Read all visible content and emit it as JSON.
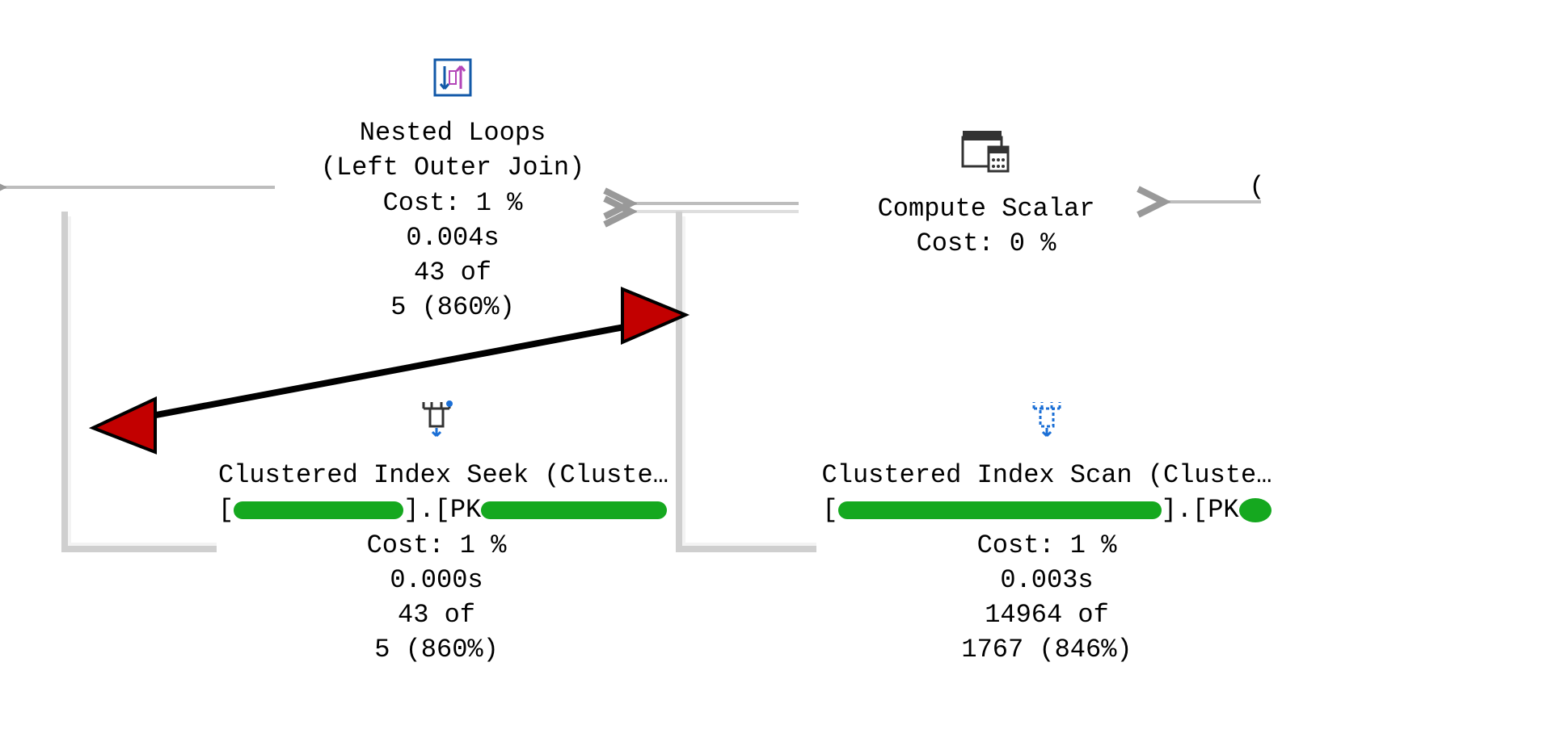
{
  "nodes": {
    "nested_loops": {
      "title": "Nested Loops",
      "subtitle": "(Left Outer Join)",
      "cost": "Cost: 1 %",
      "time": "0.004s",
      "rows_line1": "43 of",
      "rows_line2": "5 (860%)"
    },
    "compute_scalar": {
      "title": "Compute Scalar",
      "cost": "Cost: 0 %"
    },
    "index_seek": {
      "title": "Clustered Index Seek (Cluste…",
      "object_prefix": "[",
      "object_mid": "].[PK",
      "cost": "Cost: 1 %",
      "time": "0.000s",
      "rows_line1": "43 of",
      "rows_line2": "5 (860%)"
    },
    "index_scan": {
      "title": "Clustered Index Scan (Cluste…",
      "object_prefix": "[",
      "object_mid": "].[PK",
      "cost": "Cost: 1 %",
      "time": "0.003s",
      "rows_line1": "14964 of",
      "rows_line2": "1767 (846%)"
    },
    "truncated": "("
  },
  "annotation": {
    "type": "double-arrow",
    "color": "#c20000"
  }
}
